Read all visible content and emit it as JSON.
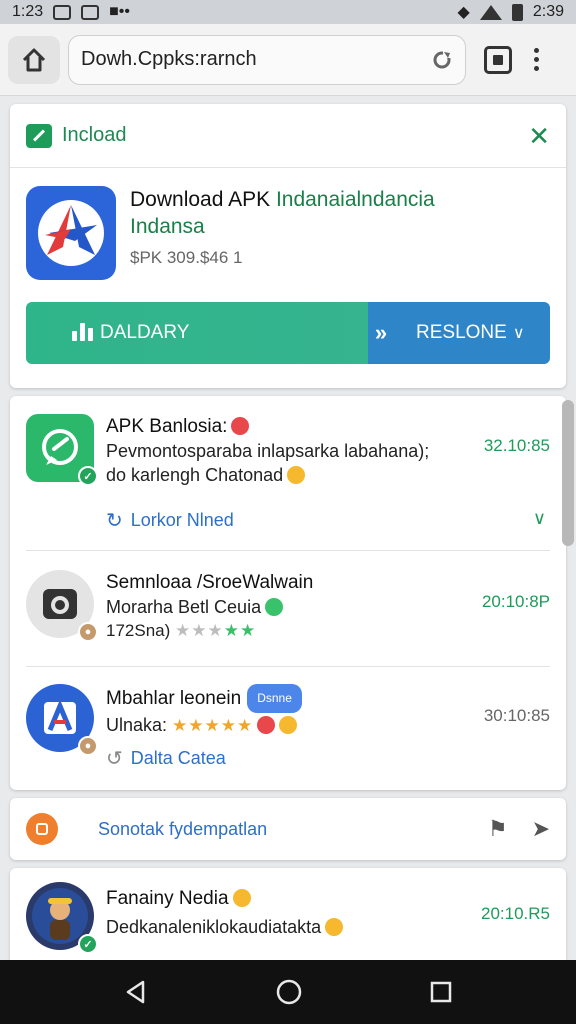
{
  "status_bar": {
    "time_left": "1:23",
    "time_right": "2:39"
  },
  "browser": {
    "url": "Dowh.Cppks:rarnch"
  },
  "download_card": {
    "header_title": "Incload",
    "app_name_prefix": "Download APK",
    "app_name_highlight": "Indanaialndancia",
    "app_name_line2": "Indansa",
    "price": "$PK 309.$46 1",
    "primary_button": "DALDARY",
    "secondary_button": "RESLONE",
    "colors": {
      "primary": "#2fb58a",
      "secondary": "#2e86c9",
      "accent": "#1d8a52"
    }
  },
  "list": [
    {
      "title": "APK Banlosia:",
      "line2": "Pevmontosparaba inlapsarka labahana);",
      "line3": "do karlengh Chatonad",
      "time": "32.10:85",
      "link": "Lorkor Nlned",
      "time_color": "#1f9b5a"
    },
    {
      "title": "Semnloaa /SroeWalwain",
      "line2": "Morarha Betl Ceuia",
      "line3": "172Sna)",
      "time": "20:10:8P",
      "time_color": "#1f9b5a"
    },
    {
      "title": "Mbahlar leonein",
      "pill": "Dsnne",
      "line2": "Ulnaka:",
      "time": "30:10:85",
      "link": "Dalta Catea",
      "time_color": "#666666"
    }
  ],
  "action_bar": {
    "text": "Sonotak fydempatlan"
  },
  "bottom_item": {
    "title": "Fanainy Nedia",
    "line2": "Dedkanaleniklokaudiatakta",
    "time": "20:10.R5",
    "time_color": "#1f9b5a"
  }
}
